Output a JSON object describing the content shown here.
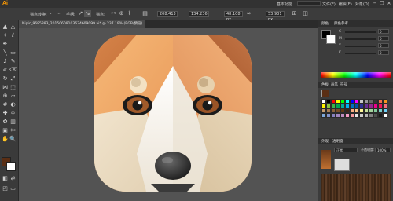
{
  "app": {
    "logo": "Ai",
    "workspace": "基本功能",
    "search_placeholder": ""
  },
  "menu": [
    "文件(F)",
    "编辑(E)",
    "对象(O)"
  ],
  "window_controls": [
    "─",
    "❐",
    "✕"
  ],
  "controlbar": {
    "label": "锚点",
    "convert_label": "转换:",
    "handles_label": "手柄:",
    "anchor_label": "锚点:",
    "x_value": "208.413",
    "y_value": "134.236",
    "w_value": "48.108 px",
    "h_value": "53.931 px"
  },
  "document": {
    "tab_title": "Nipic_9685883_20150609103634609099.ai* @ 237.19% (RGB/预览)"
  },
  "toolbar": {
    "tools": [
      "selection-tool",
      "direct-selection-tool",
      "magic-wand-tool",
      "lasso-tool",
      "pen-tool",
      "type-tool",
      "line-tool",
      "rectangle-tool",
      "paintbrush-tool",
      "pencil-tool",
      "blob-brush-tool",
      "eraser-tool",
      "rotate-tool",
      "scale-tool",
      "width-tool",
      "free-transform-tool",
      "shape-builder-tool",
      "perspective-tool",
      "mesh-tool",
      "gradient-tool",
      "eyedropper-tool",
      "blend-tool",
      "symbol-sprayer-tool",
      "column-graph-tool",
      "artboard-tool",
      "slice-tool",
      "hand-tool",
      "zoom-tool"
    ],
    "fill_color": "#5a2e14",
    "stroke_color": "#ffffff"
  },
  "color_panel": {
    "tabs": [
      "颜色",
      "颜色参考"
    ],
    "channels": [
      {
        "name": "C",
        "value": "0"
      },
      {
        "name": "M",
        "value": "0"
      },
      {
        "name": "Y",
        "value": "0"
      },
      {
        "name": "K",
        "value": "0"
      }
    ]
  },
  "swatches_panel": {
    "tabs": [
      "色板",
      "画笔",
      "符号"
    ],
    "colors": [
      "#ffffff",
      "#000000",
      "#ff0000",
      "#ffff00",
      "#00ff00",
      "#00ffff",
      "#0000ff",
      "#ff00ff",
      "#c8c8c8",
      "#999999",
      "#666666",
      "#333333",
      "#f26c4f",
      "#f7941d",
      "#fff200",
      "#8dc63f",
      "#39b54a",
      "#00a651",
      "#00a99d",
      "#00aeef",
      "#0072bc",
      "#0054a6",
      "#2e3192",
      "#662d91",
      "#92278f",
      "#ec008c",
      "#ed145b",
      "#f26d7d",
      "#c69c6d",
      "#a67c52",
      "#8c6239",
      "#754c24",
      "#603913",
      "#3c2415",
      "#f9ad81",
      "#fdc689",
      "#fff799",
      "#c4df9b",
      "#a3d39c",
      "#82ca9c",
      "#7accc8",
      "#6dcff6",
      "#7da7d9",
      "#8393ca",
      "#8781bd",
      "#a186be",
      "#bd8cbf",
      "#f49ac1",
      "#f5989d",
      "#e6e6e6",
      "#cccccc",
      "#b3b3b3",
      "#808080",
      "#4d4d4d",
      "#1a1a1a",
      "#ffffff"
    ]
  },
  "appearance_panel": {
    "tabs": [
      "外观",
      "透明度"
    ],
    "mode_label": "正常",
    "opacity_label": "不透明度:",
    "opacity_value": "100%"
  }
}
